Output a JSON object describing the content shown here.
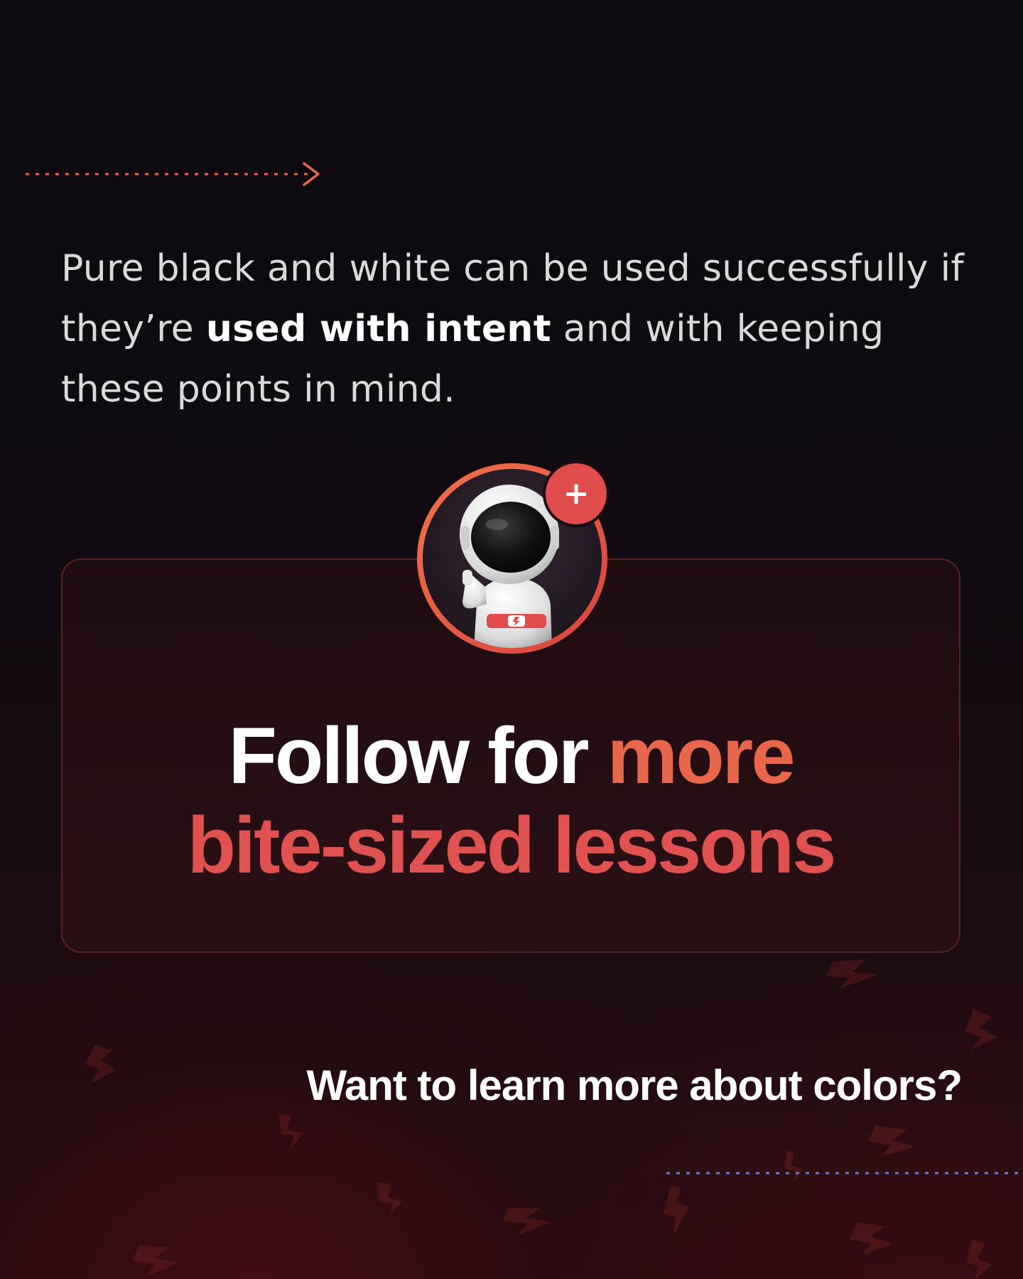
{
  "intro": {
    "text_before": "Pure black and white can be used successfully if they’re ",
    "text_bold": "used with intent",
    "text_after": " and with keeping these points in mind."
  },
  "cta": {
    "line1_white": "Follow for ",
    "line1_accent": "more",
    "line2_accent": "bite-sized lessons"
  },
  "avatar": {
    "badge_symbol": "+"
  },
  "question": {
    "text": "Want to learn more about colors?"
  },
  "colors": {
    "accent_orange": "#e8664c",
    "accent_red": "#e05252",
    "dots_blue": "#6a7fc8"
  },
  "icons": {
    "top_arrow": "dotted-arrow-right-icon",
    "background": "lightning-bolt-icon",
    "badge": "plus-icon"
  }
}
